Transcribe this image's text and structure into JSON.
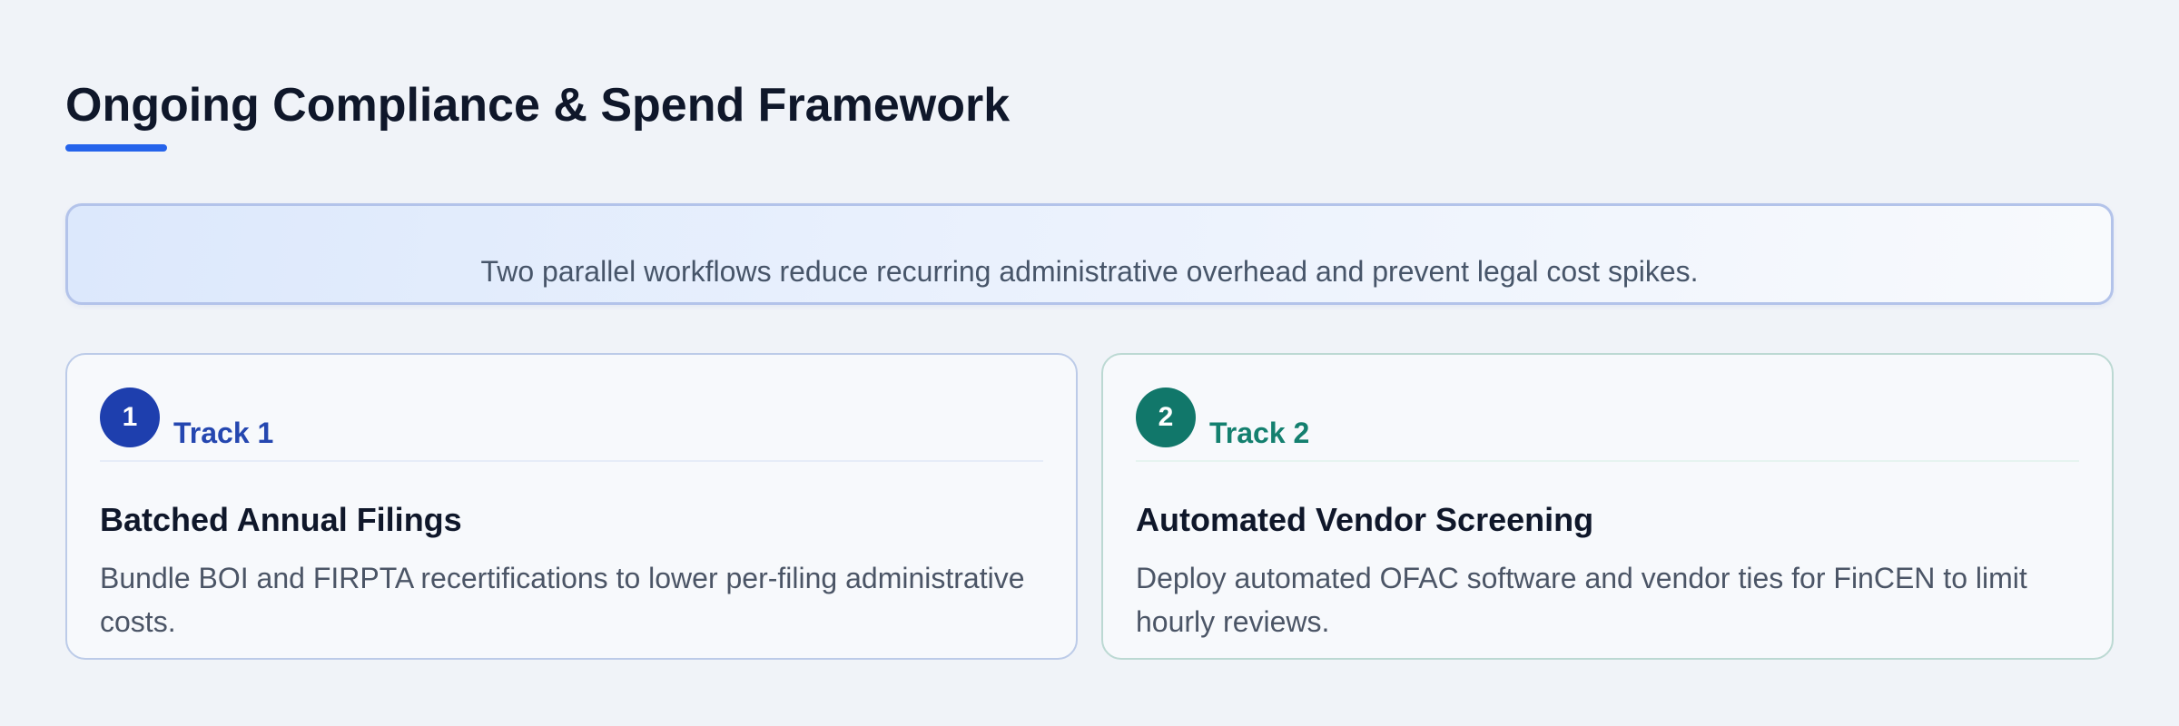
{
  "page": {
    "title": "Ongoing Compliance & Spend Framework"
  },
  "banner": {
    "text": "Two parallel workflows reduce recurring administrative overhead and prevent legal cost spikes."
  },
  "tracks": [
    {
      "number": "1",
      "label": "Track 1",
      "title": "Batched Annual Filings",
      "description": "Bundle BOI and FIRPTA recertifications to lower per-filing administrative costs.",
      "accent_color": "#1e3fae"
    },
    {
      "number": "2",
      "label": "Track 2",
      "title": "Automated Vendor Screening",
      "description": "Deploy automated OFAC software and vendor ties for FinCEN to limit hourly reviews.",
      "accent_color": "#11776a"
    }
  ],
  "colors": {
    "background": "#f0f3f8",
    "title_underline": "#2563eb",
    "heading_text": "#0f172a",
    "body_text": "#4b5566"
  }
}
